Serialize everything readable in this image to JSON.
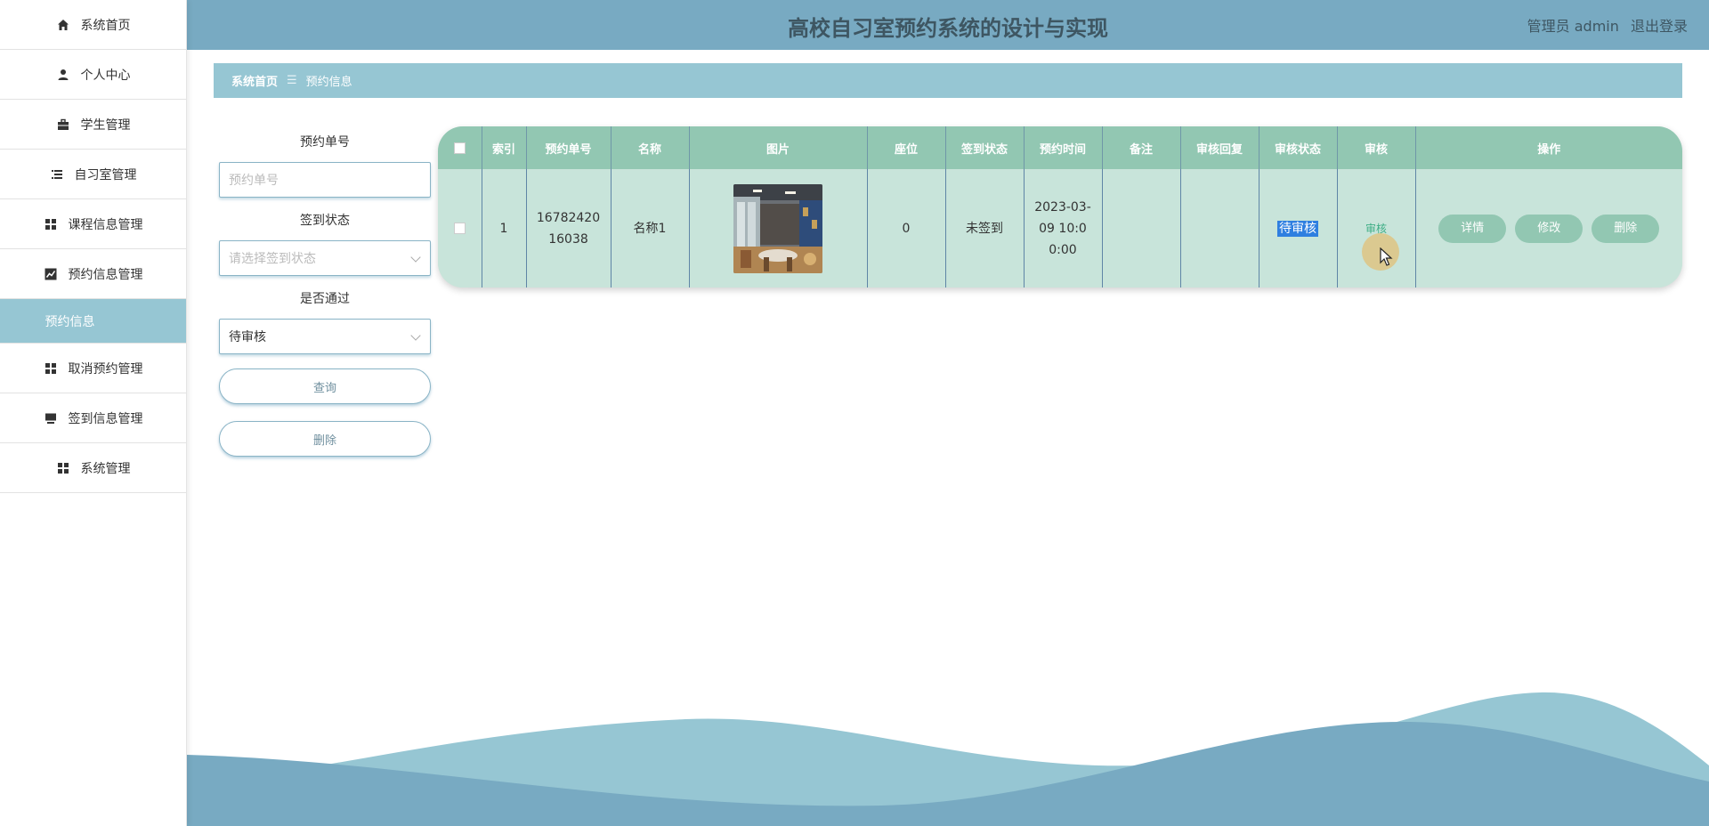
{
  "header": {
    "title": "高校自习室预约系统的设计与实现",
    "user_label": "管理员 admin",
    "logout_label": "退出登录"
  },
  "sidebar": {
    "items": [
      {
        "label": "系统首页",
        "icon": "home-icon"
      },
      {
        "label": "个人中心",
        "icon": "user-icon"
      },
      {
        "label": "学生管理",
        "icon": "briefcase-icon"
      },
      {
        "label": "自习室管理",
        "icon": "list-icon"
      },
      {
        "label": "课程信息管理",
        "icon": "grid-icon"
      },
      {
        "label": "预约信息管理",
        "icon": "chart-icon"
      },
      {
        "label": "预约信息",
        "icon": ""
      },
      {
        "label": "取消预约管理",
        "icon": "grid-icon"
      },
      {
        "label": "签到信息管理",
        "icon": "monitor-icon"
      },
      {
        "label": "系统管理",
        "icon": "grid-icon"
      }
    ]
  },
  "breadcrumb": {
    "home": "系统首页",
    "separator": "☰",
    "current": "预约信息"
  },
  "filters": {
    "order_no_label": "预约单号",
    "order_no_placeholder": "预约单号",
    "checkin_label": "签到状态",
    "checkin_placeholder": "请选择签到状态",
    "pass_label": "是否通过",
    "pass_value": "待审核",
    "query_label": "查询",
    "delete_label": "删除"
  },
  "table": {
    "headers": [
      "索引",
      "预约单号",
      "名称",
      "图片",
      "座位",
      "签到状态",
      "预约时间",
      "备注",
      "审核回复",
      "审核状态",
      "审核",
      "操作"
    ],
    "rows": [
      {
        "index": "1",
        "order_no": "1678242016038",
        "name": "名称1",
        "seat": "0",
        "checkin_status": "未签到",
        "time": "2023-03-09 10:00:00",
        "remark": "",
        "review_reply": "",
        "review_status": "待审核",
        "review_action": "审核",
        "ops": [
          "详情",
          "修改",
          "删除"
        ]
      }
    ]
  },
  "colors": {
    "header_bg": "#78aac2",
    "breadcrumb_bg": "#96c6d3",
    "table_header_bg": "#92c7b2",
    "table_row_bg": "#c8e4da",
    "wave_light": "#96c6d3",
    "wave_dark": "#78aac2"
  }
}
